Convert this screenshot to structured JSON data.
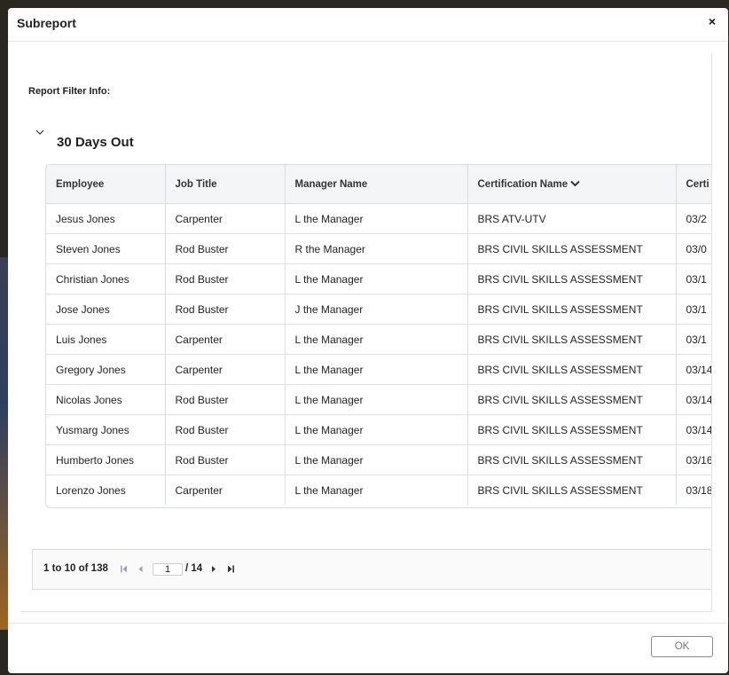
{
  "dialog": {
    "title": "Subreport",
    "close_glyph": "×"
  },
  "report": {
    "filter_label": "Report Filter Info:",
    "group_title": "30 Days Out"
  },
  "table": {
    "columns": [
      "Employee",
      "Job Title",
      "Manager Name",
      "Certification Name",
      "Certi"
    ],
    "sorted_column": "Certification Name",
    "sort_direction": "descending",
    "rows": [
      [
        "Jesus Jones",
        "Carpenter",
        "L the Manager",
        "BRS ATV-UTV",
        "03/2"
      ],
      [
        "Steven Jones",
        "Rod Buster",
        "R the Manager",
        "BRS CIVIL SKILLS ASSESSMENT",
        "03/0"
      ],
      [
        "Christian Jones",
        "Rod Buster",
        "L the Manager",
        "BRS CIVIL SKILLS ASSESSMENT",
        "03/1"
      ],
      [
        "Jose Jones",
        "Rod Buster",
        "J the Manager",
        "BRS CIVIL SKILLS ASSESSMENT",
        "03/1"
      ],
      [
        "Luis Jones",
        "Carpenter",
        "L the Manager",
        "BRS CIVIL SKILLS ASSESSMENT",
        "03/1"
      ],
      [
        "Gregory Jones",
        "Carpenter",
        "L the Manager",
        "BRS CIVIL SKILLS ASSESSMENT",
        "03/14"
      ],
      [
        "Nicolas Jones",
        "Rod Buster",
        "L the Manager",
        "BRS CIVIL SKILLS ASSESSMENT",
        "03/14"
      ],
      [
        "Yusmarg Jones",
        "Rod Buster",
        "L the Manager",
        "BRS CIVIL SKILLS ASSESSMENT",
        "03/14"
      ],
      [
        "Humberto Jones",
        "Rod Buster",
        "L the Manager",
        "BRS CIVIL SKILLS ASSESSMENT",
        "03/16"
      ],
      [
        "Lorenzo Jones",
        "Carpenter",
        "L the Manager",
        "BRS CIVIL SKILLS ASSESSMENT",
        "03/18"
      ]
    ]
  },
  "pagination": {
    "summary": "1 to 10 of 138",
    "current_page": "1",
    "total_label": "/ 14"
  },
  "footer": {
    "ok_label": "OK"
  }
}
